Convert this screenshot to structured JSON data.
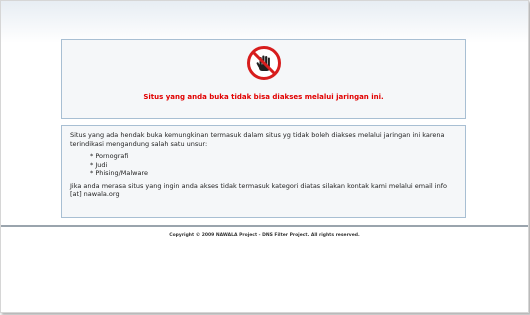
{
  "blocked_panel": {
    "icon": "no-entry-hand-icon",
    "message": "Situs yang anda buka tidak bisa diakses melalui jaringan ini."
  },
  "info_panel": {
    "intro": "Situs yang ada hendak buka kemungkinan termasuk dalam situs yg tidak boleh diakses melalui jaringan ini karena terindikasi mengandung salah satu unsur:",
    "items": [
      "* Pornografi",
      "* Judi",
      "* Phising/Malware"
    ],
    "contact": "Jika anda merasa situs yang ingin anda akses tidak termasuk kategori diatas silakan kontak kami melalui email info [at] nawala.org"
  },
  "footer": {
    "copyright": "Copyright © 2009 NAWALA Project - DNS Filter Project. All rights reserved."
  },
  "colors": {
    "warning": "#e10000",
    "panel_border": "#a8bfd3",
    "panel_background": "#f5f7f9"
  }
}
